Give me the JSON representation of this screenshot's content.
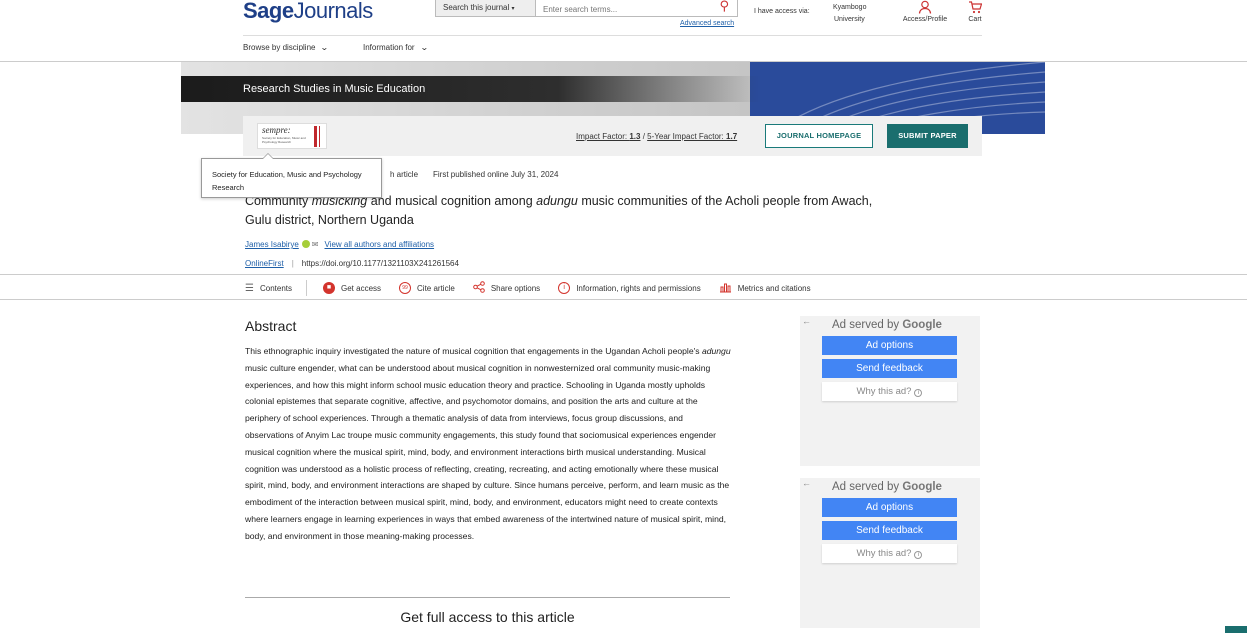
{
  "header": {
    "logo_bold": "Sage",
    "logo_light": "Journals",
    "search_scope": "Search this journal",
    "search_placeholder": "Enter search terms...",
    "advanced_search": "Advanced search",
    "access_via": "I have access via:",
    "institution_line1": "Kyambogo",
    "institution_line2": "University",
    "access_profile": "Access/Profile",
    "cart": "Cart"
  },
  "nav": {
    "browse": "Browse by discipline",
    "information": "Information for"
  },
  "banner": {
    "journal_title": "Research Studies in Music Education"
  },
  "journal_bar": {
    "logo_text": "sempre:",
    "logo_sub": "Society for Education, Music and Psychology Research",
    "impact_label": "Impact Factor: ",
    "impact_value": "1.3",
    "separator": " / ",
    "five_year_label": "5-Year Impact Factor: ",
    "five_year_value": "1.7",
    "homepage_button": "JOURNAL HOMEPAGE",
    "submit_button": "SUBMIT PAPER"
  },
  "tooltip": {
    "text": "Society for Education, Music and Psychology Research"
  },
  "article": {
    "type": "h article",
    "published": "First published online July 31, 2024",
    "title_part1": "Community ",
    "title_italic1": "musicking",
    "title_part2": " and musical cognition among ",
    "title_italic2": "adungu",
    "title_part3": " music communities of the Acholi people from Awach, Gulu district, Northern Uganda",
    "author": "James Isabirye",
    "view_all": "View all authors and affiliations",
    "status": "OnlineFirst",
    "doi": "https://doi.org/10.1177/1321103X241261564"
  },
  "toolbar": {
    "contents": "Contents",
    "get_access": "Get access",
    "cite": "Cite article",
    "share": "Share options",
    "info": "Information, rights and permissions",
    "metrics": "Metrics and citations"
  },
  "abstract": {
    "heading": "Abstract",
    "text_before": "This ethnographic inquiry investigated the nature of musical cognition that engagements in the Ugandan Acholi people's ",
    "text_italic": "adungu",
    "text_after": " music culture engender, what can be understood about musical cognition in nonwesternized oral community music-making experiences, and how this might inform school music education theory and practice. Schooling in Uganda mostly upholds colonial epistemes that separate cognitive, affective, and psychomotor domains, and position the arts and culture at the periphery of school experiences. Through a thematic analysis of data from interviews, focus group discussions, and observations of Anyim Lac troupe music community engagements, this study found that sociomusical experiences engender musical cognition where the musical spirit, mind, body, and environment interactions birth musical understanding. Musical cognition was understood as a holistic process of reflecting, creating, recreating, and acting emotionally where these musical spirit, mind, body, and environment interactions are shaped by culture. Since humans perceive, perform, and learn music as the embodiment of the interaction between musical spirit, mind, body, and environment, educators might need to create contexts where learners engage in learning experiences in ways that embed awareness of the intertwined nature of musical spirit, mind, body, and environment in those meaning-making processes.",
    "get_full_access": "Get full access to this article"
  },
  "ads": [
    {
      "served_by": "Ad served by ",
      "brand": "Google",
      "options": "Ad options",
      "feedback": "Send feedback",
      "why": "Why this ad?"
    },
    {
      "served_by": "Ad served by ",
      "brand": "Google",
      "options": "Ad options",
      "feedback": "Send feedback",
      "why": "Why this ad?"
    }
  ],
  "colors": {
    "brand_blue": "#1e3f87",
    "teal": "#1a6e6e",
    "link": "#1e5fa8",
    "accent_red": "#d3342d",
    "ad_blue": "#4285f4"
  }
}
